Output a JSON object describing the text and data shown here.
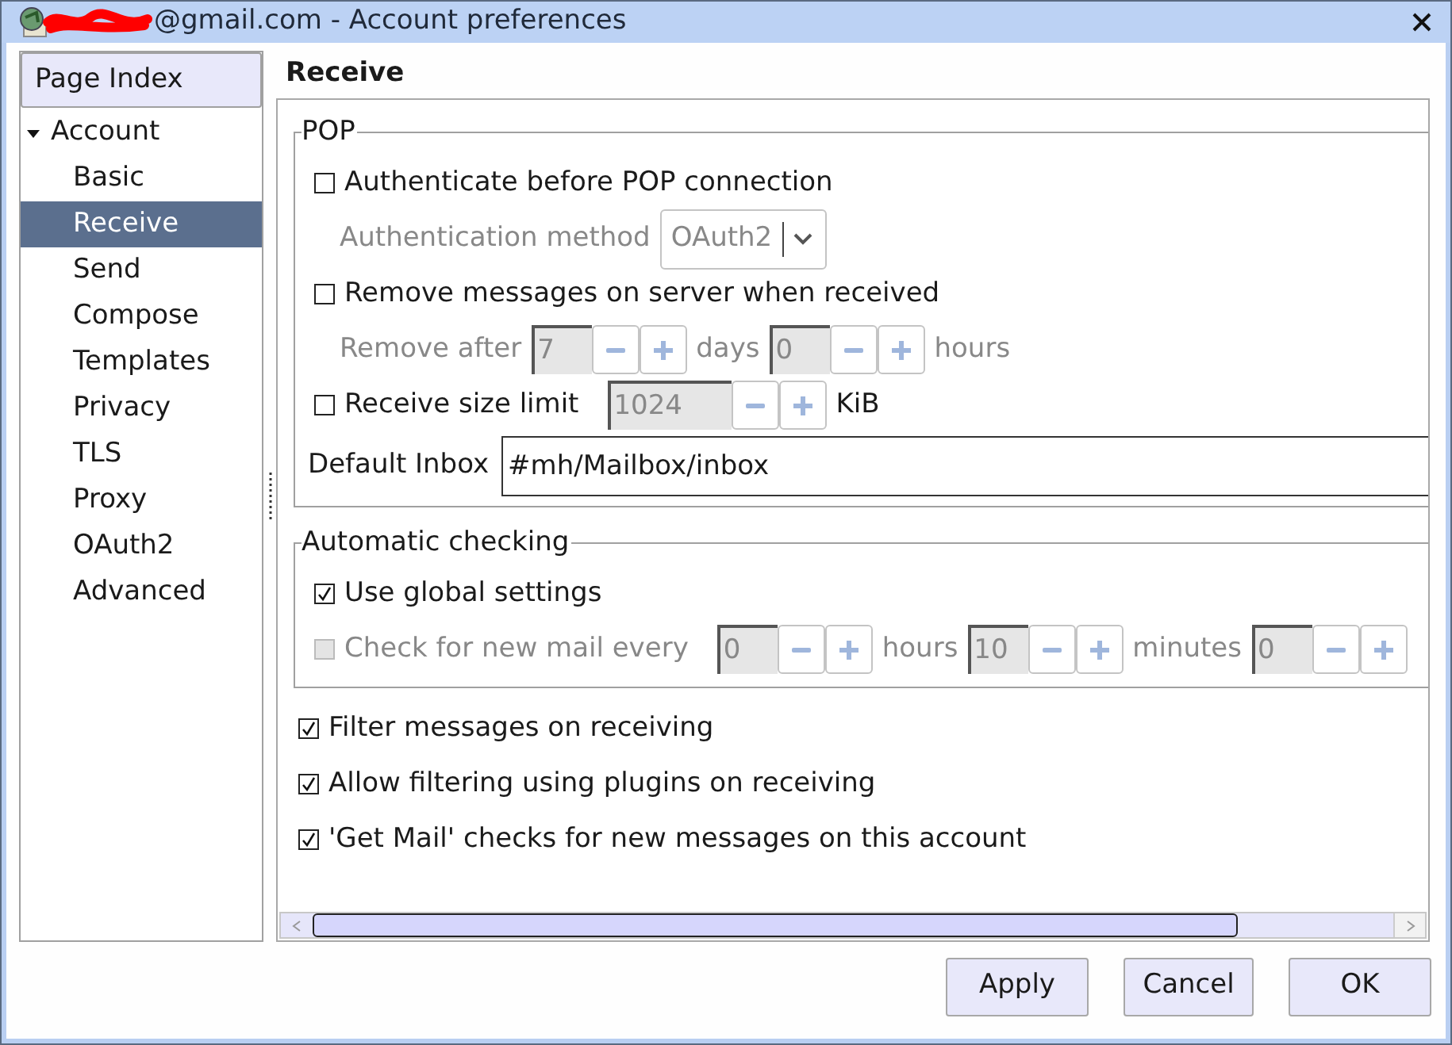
{
  "window": {
    "title": "@gmail.com - Account preferences"
  },
  "sidebar": {
    "header": "Page Index",
    "items": [
      {
        "label": "Account",
        "expanded": true,
        "selected": false,
        "children": [
          {
            "label": "Basic",
            "selected": false
          },
          {
            "label": "Receive",
            "selected": true
          },
          {
            "label": "Send",
            "selected": false
          },
          {
            "label": "Compose",
            "selected": false
          },
          {
            "label": "Templates",
            "selected": false
          },
          {
            "label": "Privacy",
            "selected": false
          },
          {
            "label": "TLS",
            "selected": false
          },
          {
            "label": "Proxy",
            "selected": false
          },
          {
            "label": "OAuth2",
            "selected": false
          },
          {
            "label": "Advanced",
            "selected": false
          }
        ]
      }
    ]
  },
  "page": {
    "title": "Receive"
  },
  "groups": [
    {
      "legend": "POP",
      "rows": [
        {
          "indent": false,
          "parts": [
            {
              "kind": "checkbox",
              "label": "Authenticate before POP connection",
              "checked": false,
              "disabled": false
            }
          ]
        },
        {
          "indent": true,
          "parts": [
            {
              "kind": "text",
              "text": "Authentication method",
              "disabled": true
            },
            {
              "kind": "combo",
              "value": "OAuth2",
              "disabled": true
            }
          ]
        },
        {
          "indent": false,
          "parts": [
            {
              "kind": "checkbox",
              "label": "Remove messages on server when received",
              "checked": false,
              "disabled": false
            }
          ]
        },
        {
          "indent": true,
          "parts": [
            {
              "kind": "text",
              "text": "Remove after",
              "disabled": true
            },
            {
              "kind": "spin",
              "value": "7",
              "disabled": true
            },
            {
              "kind": "text",
              "text": "days",
              "disabled": true
            },
            {
              "kind": "spin",
              "value": "0",
              "disabled": true
            },
            {
              "kind": "text",
              "text": "hours",
              "disabled": true
            }
          ]
        },
        {
          "indent": false,
          "parts": [
            {
              "kind": "checkbox",
              "label": "Receive size limit",
              "checked": false,
              "disabled": false
            },
            {
              "kind": "spin",
              "value": "1024",
              "disabled": true
            },
            {
              "kind": "text",
              "text": "KiB",
              "disabled": false
            }
          ]
        },
        {
          "indent": false,
          "parts": [
            {
              "kind": "text",
              "text": "Default Inbox",
              "disabled": false
            },
            {
              "kind": "entry",
              "value": "#mh/Mailbox/inbox",
              "disabled": false
            }
          ]
        }
      ]
    },
    {
      "legend": "Automatic checking",
      "rows": [
        {
          "indent": false,
          "parts": [
            {
              "kind": "checkbox",
              "label": "Use global settings",
              "checked": true,
              "disabled": false
            }
          ]
        },
        {
          "indent": false,
          "parts": [
            {
              "kind": "checkbox",
              "label": "Check for new mail every",
              "checked": false,
              "disabled": true
            },
            {
              "kind": "spin",
              "value": "0",
              "disabled": true
            },
            {
              "kind": "text",
              "text": "hours",
              "disabled": true
            },
            {
              "kind": "spin",
              "value": "10",
              "disabled": true
            },
            {
              "kind": "text",
              "text": "minutes",
              "disabled": true
            },
            {
              "kind": "spin",
              "value": "0",
              "disabled": true
            }
          ]
        }
      ]
    }
  ],
  "options": [
    {
      "label": "Filter messages on receiving",
      "checked": true
    },
    {
      "label": "Allow filtering using plugins on receiving",
      "checked": true
    },
    {
      "label": "'Get Mail' checks for new messages on this account",
      "checked": true
    }
  ],
  "buttons": [
    "Apply",
    "Cancel",
    "OK"
  ]
}
